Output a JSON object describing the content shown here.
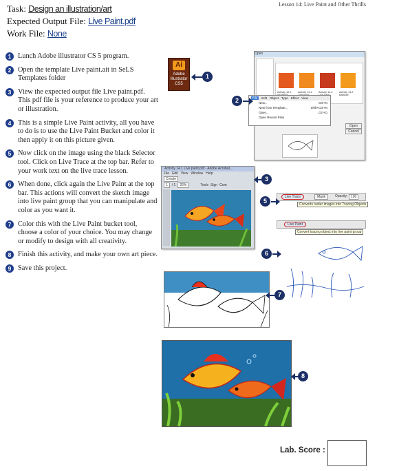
{
  "lesson_header": "Lesson 14: Live Paint and Other Thrills",
  "task": {
    "task_label": "Task:",
    "task_value": "Design an illustration/art",
    "output_label": "Expected Output File:",
    "output_value": "Live Paint.pdf",
    "work_label": "Work File:",
    "work_value": "None"
  },
  "steps": [
    {
      "num": "1",
      "text": "Lunch Adobe illustrator CS 5 program."
    },
    {
      "num": "2",
      "text": "Open the template Live paint.ait in SeLS Templates folder"
    },
    {
      "num": "3",
      "text": "View the expected output file Live paint.pdf. This pdf file is your reference to produce your art or illustration."
    },
    {
      "num": "4",
      "text": "This is a simple Live Paint activity, all you have to do is to use the Live Paint Bucket and color it then apply it on this picture given."
    },
    {
      "num": "5",
      "text": "Now click on the image using the black Selector tool. Click on Live Trace at the top bar. Refer to your work text on the live trace lesson."
    },
    {
      "num": "6",
      "text": "When done, click again the Live Paint at the top bar. This actions will convert the sketch image into live paint group that you can manipulate and color as you want it."
    },
    {
      "num": "7",
      "text": "Color this with the Live Paint bucket tool, choose a color of your choice. You may change or modify to design with all creativity."
    },
    {
      "num": "8",
      "text": "Finish this activity, and make your own art piece."
    },
    {
      "num": "9",
      "text": "Save this project."
    }
  ],
  "callouts": {
    "c1": "1",
    "c2": "2",
    "c3": "3",
    "c5": "5",
    "c6": "6",
    "c7": "7",
    "c8": "8"
  },
  "illustrator_icon": {
    "glyph": "Ai",
    "caption": "Adobe Illustrator CS5"
  },
  "open_dialog": {
    "title": "Open",
    "files": [
      "Activity 12.1 Workflow",
      "Activity 14.1 Live paint",
      "Activity 14.2 Live paint",
      "Activity 14.2 Balance"
    ],
    "menu_bar": [
      "File",
      "Edit",
      "Object",
      "Type",
      "Effect",
      "View"
    ],
    "menu_items": [
      {
        "label": "New...",
        "shortcut": "Ctrl+N"
      },
      {
        "label": "New from Template...",
        "shortcut": "Shift+Ctrl+N"
      },
      {
        "label": "Open...",
        "shortcut": "Ctrl+O"
      },
      {
        "label": "Open Recent Files",
        "shortcut": ""
      }
    ],
    "buttons": [
      "Open",
      "Cancel"
    ]
  },
  "acrobat_window": {
    "title": "Activity 14.1 Live paint.pdf - Adobe Acrobat...",
    "menu": [
      "File",
      "Edit",
      "View",
      "Window",
      "Help"
    ],
    "create_label": "Create",
    "page_field": "1",
    "page_total": "/ 1",
    "zoom": "26%",
    "tabs": [
      "Tools",
      "Sign",
      "Com"
    ]
  },
  "live_trace_bar": {
    "button": "Live Trace",
    "mask": "Mask",
    "opacity_label": "Opacity:",
    "opacity_value": "100",
    "tooltip": "Converts raster images into Tracing Objects"
  },
  "live_paint_bar": {
    "button": "Live Paint",
    "tooltip": "Convert tracing object into live paint group"
  },
  "lab_score_label": "Lab. Score :",
  "colors": {
    "accent": "#1f3e8c",
    "callout": "#1c2f66",
    "link": "#1b3f8a",
    "highlight": "#c22222"
  }
}
